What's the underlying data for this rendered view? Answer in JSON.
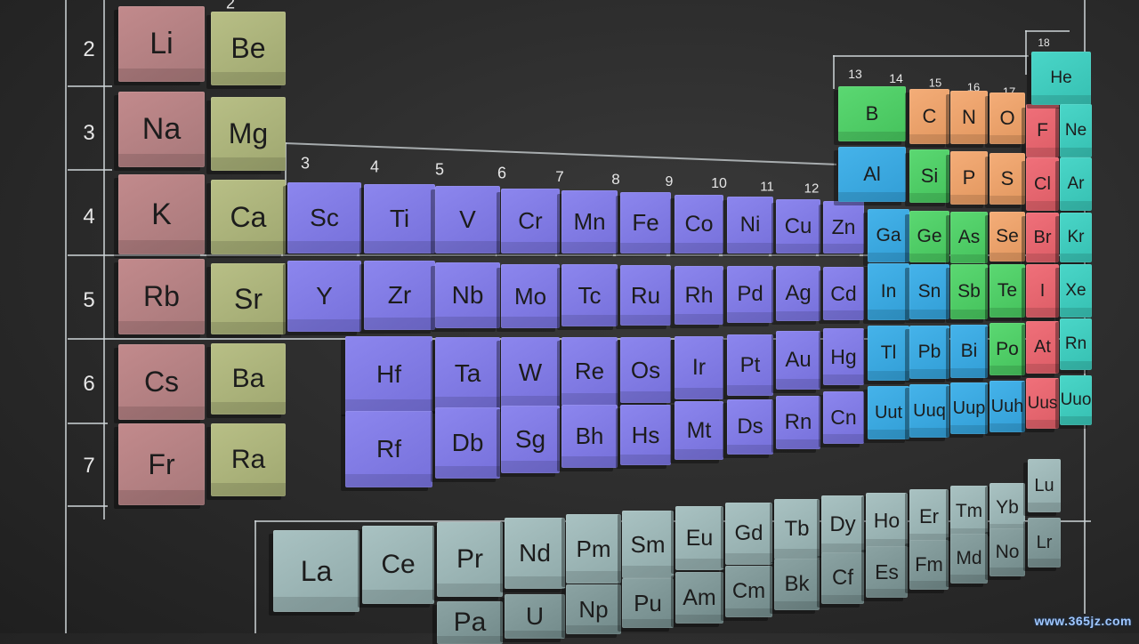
{
  "table": {
    "period_labels": [
      "2",
      "3",
      "4",
      "5",
      "6",
      "7"
    ],
    "group_labels": [
      "2",
      "3",
      "4",
      "5",
      "6",
      "7",
      "8",
      "9",
      "10",
      "11",
      "12",
      "13",
      "14",
      "15",
      "16",
      "17",
      "18"
    ],
    "elements": [
      {
        "symbol": "Li",
        "class": "alkali"
      },
      {
        "symbol": "Be",
        "class": "earth"
      },
      {
        "symbol": "Na",
        "class": "alkali"
      },
      {
        "symbol": "Mg",
        "class": "earth"
      },
      {
        "symbol": "K",
        "class": "alkali"
      },
      {
        "symbol": "Ca",
        "class": "earth"
      },
      {
        "symbol": "Rb",
        "class": "alkali"
      },
      {
        "symbol": "Sr",
        "class": "earth"
      },
      {
        "symbol": "Cs",
        "class": "alkali"
      },
      {
        "symbol": "Ba",
        "class": "earth"
      },
      {
        "symbol": "Fr",
        "class": "alkali"
      },
      {
        "symbol": "Ra",
        "class": "earth"
      },
      {
        "symbol": "Sc",
        "class": "trans"
      },
      {
        "symbol": "Ti",
        "class": "trans"
      },
      {
        "symbol": "V",
        "class": "trans"
      },
      {
        "symbol": "Cr",
        "class": "trans"
      },
      {
        "symbol": "Mn",
        "class": "trans"
      },
      {
        "symbol": "Fe",
        "class": "trans"
      },
      {
        "symbol": "Co",
        "class": "trans"
      },
      {
        "symbol": "Ni",
        "class": "trans"
      },
      {
        "symbol": "Cu",
        "class": "trans"
      },
      {
        "symbol": "Zn",
        "class": "trans"
      },
      {
        "symbol": "Y",
        "class": "trans"
      },
      {
        "symbol": "Zr",
        "class": "trans"
      },
      {
        "symbol": "Nb",
        "class": "trans"
      },
      {
        "symbol": "Mo",
        "class": "trans"
      },
      {
        "symbol": "Tc",
        "class": "trans"
      },
      {
        "symbol": "Ru",
        "class": "trans"
      },
      {
        "symbol": "Rh",
        "class": "trans"
      },
      {
        "symbol": "Pd",
        "class": "trans"
      },
      {
        "symbol": "Ag",
        "class": "trans"
      },
      {
        "symbol": "Cd",
        "class": "trans"
      },
      {
        "symbol": "Hf",
        "class": "trans"
      },
      {
        "symbol": "Ta",
        "class": "trans"
      },
      {
        "symbol": "W",
        "class": "trans"
      },
      {
        "symbol": "Re",
        "class": "trans"
      },
      {
        "symbol": "Os",
        "class": "trans"
      },
      {
        "symbol": "Ir",
        "class": "trans"
      },
      {
        "symbol": "Pt",
        "class": "trans"
      },
      {
        "symbol": "Au",
        "class": "trans"
      },
      {
        "symbol": "Hg",
        "class": "trans"
      },
      {
        "symbol": "Rf",
        "class": "trans"
      },
      {
        "symbol": "Db",
        "class": "trans"
      },
      {
        "symbol": "Sg",
        "class": "trans"
      },
      {
        "symbol": "Bh",
        "class": "trans"
      },
      {
        "symbol": "Hs",
        "class": "trans"
      },
      {
        "symbol": "Mt",
        "class": "trans"
      },
      {
        "symbol": "Ds",
        "class": "trans"
      },
      {
        "symbol": "Rn",
        "class": "trans"
      },
      {
        "symbol": "Cn",
        "class": "trans"
      },
      {
        "symbol": "B",
        "class": "metal"
      },
      {
        "symbol": "C",
        "class": "nonmet"
      },
      {
        "symbol": "N",
        "class": "nonmet"
      },
      {
        "symbol": "O",
        "class": "nonmet"
      },
      {
        "symbol": "F",
        "class": "halo"
      },
      {
        "symbol": "He",
        "class": "noble"
      },
      {
        "symbol": "Ne",
        "class": "noble"
      },
      {
        "symbol": "Al",
        "class": "post"
      },
      {
        "symbol": "Si",
        "class": "metal"
      },
      {
        "symbol": "P",
        "class": "nonmet"
      },
      {
        "symbol": "S",
        "class": "nonmet"
      },
      {
        "symbol": "Cl",
        "class": "halo"
      },
      {
        "symbol": "Ar",
        "class": "noble"
      },
      {
        "symbol": "Ga",
        "class": "post"
      },
      {
        "symbol": "Ge",
        "class": "metal"
      },
      {
        "symbol": "As",
        "class": "metal"
      },
      {
        "symbol": "Se",
        "class": "nonmet"
      },
      {
        "symbol": "Br",
        "class": "halo"
      },
      {
        "symbol": "Kr",
        "class": "noble"
      },
      {
        "symbol": "In",
        "class": "post"
      },
      {
        "symbol": "Sn",
        "class": "post"
      },
      {
        "symbol": "Sb",
        "class": "metal"
      },
      {
        "symbol": "Te",
        "class": "metal"
      },
      {
        "symbol": "I",
        "class": "halo"
      },
      {
        "symbol": "Xe",
        "class": "noble"
      },
      {
        "symbol": "Tl",
        "class": "post"
      },
      {
        "symbol": "Pb",
        "class": "post"
      },
      {
        "symbol": "Bi",
        "class": "post"
      },
      {
        "symbol": "Po",
        "class": "metal"
      },
      {
        "symbol": "At",
        "class": "halo"
      },
      {
        "symbol": "Rn",
        "class": "noble"
      },
      {
        "symbol": "Uut",
        "class": "post"
      },
      {
        "symbol": "Uuq",
        "class": "post"
      },
      {
        "symbol": "Uup",
        "class": "post"
      },
      {
        "symbol": "Uuh",
        "class": "post"
      },
      {
        "symbol": "Uus",
        "class": "halo"
      },
      {
        "symbol": "Uuo",
        "class": "noble"
      },
      {
        "symbol": "La",
        "class": "fblock"
      },
      {
        "symbol": "Ce",
        "class": "fblock"
      },
      {
        "symbol": "Pr",
        "class": "fblock"
      },
      {
        "symbol": "Nd",
        "class": "fblock"
      },
      {
        "symbol": "Pm",
        "class": "fblock"
      },
      {
        "symbol": "Sm",
        "class": "fblock"
      },
      {
        "symbol": "Eu",
        "class": "fblock"
      },
      {
        "symbol": "Gd",
        "class": "fblock"
      },
      {
        "symbol": "Tb",
        "class": "fblock"
      },
      {
        "symbol": "Dy",
        "class": "fblock"
      },
      {
        "symbol": "Ho",
        "class": "fblock"
      },
      {
        "symbol": "Er",
        "class": "fblock"
      },
      {
        "symbol": "Tm",
        "class": "fblock"
      },
      {
        "symbol": "Yb",
        "class": "fblock"
      },
      {
        "symbol": "Lu",
        "class": "fblock"
      },
      {
        "symbol": "Pa",
        "class": "fblock2"
      },
      {
        "symbol": "U",
        "class": "fblock2"
      },
      {
        "symbol": "Np",
        "class": "fblock2"
      },
      {
        "symbol": "Pu",
        "class": "fblock2"
      },
      {
        "symbol": "Am",
        "class": "fblock2"
      },
      {
        "symbol": "Cm",
        "class": "fblock2"
      },
      {
        "symbol": "Bk",
        "class": "fblock2"
      },
      {
        "symbol": "Cf",
        "class": "fblock2"
      },
      {
        "symbol": "Es",
        "class": "fblock2"
      },
      {
        "symbol": "Fm",
        "class": "fblock2"
      },
      {
        "symbol": "Md",
        "class": "fblock2"
      },
      {
        "symbol": "No",
        "class": "fblock2"
      },
      {
        "symbol": "Lr",
        "class": "fblock2"
      }
    ]
  },
  "colors": {
    "background": "#2b2b2b",
    "alkali": "#c28a8c",
    "earth": "#b8bf86",
    "trans": "#8c86ee",
    "post": "#45b3ea",
    "metal": "#5bd872",
    "nonmet": "#f4ad78",
    "halo": "#f0707a",
    "noble": "#4ad6c8",
    "fblock": "#a9c2c2"
  },
  "watermark": "www.365jz.com"
}
